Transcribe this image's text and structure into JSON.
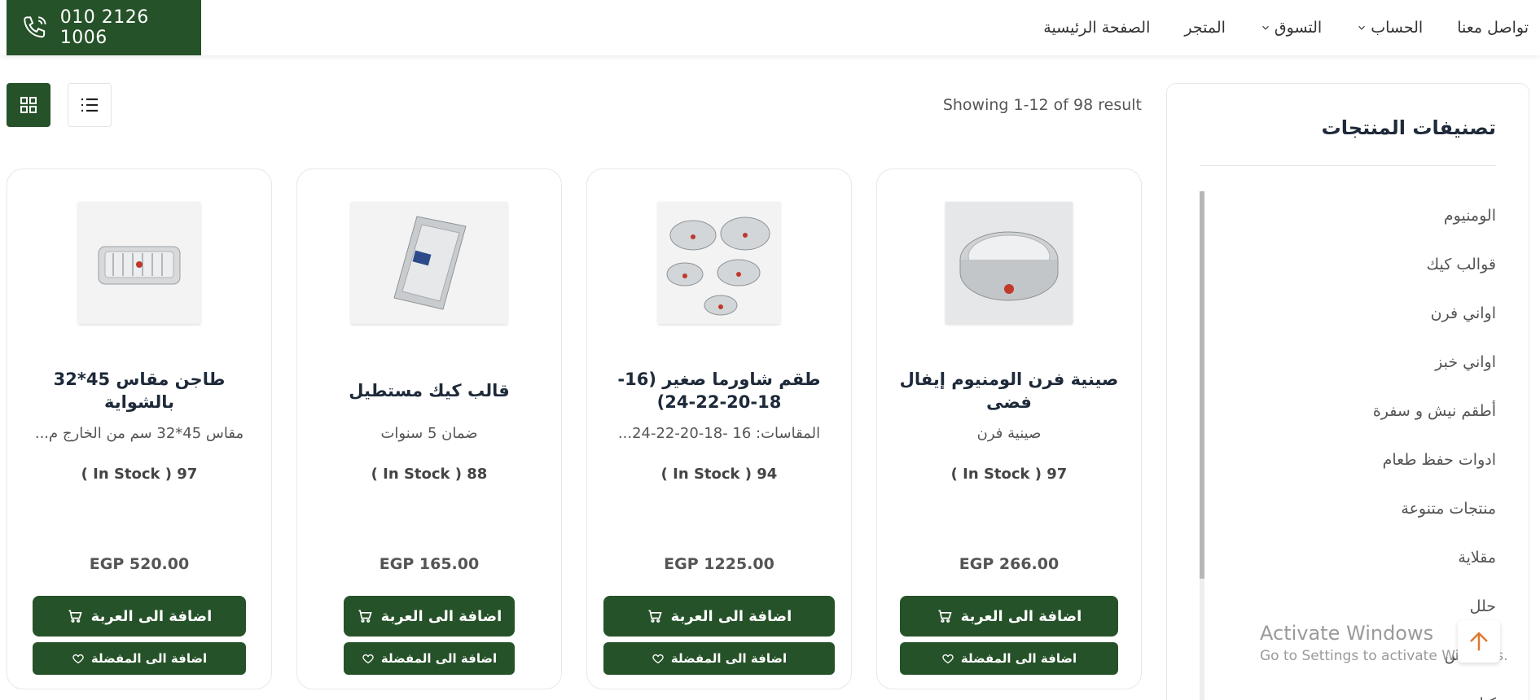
{
  "header": {
    "phone": "010 2126 1006",
    "nav": [
      {
        "label": "الصفحة الرئيسية",
        "dropdown": false
      },
      {
        "label": "المتجر",
        "dropdown": false
      },
      {
        "label": "التسوق",
        "dropdown": true
      },
      {
        "label": "الحساب",
        "dropdown": true
      },
      {
        "label": "تواصل معنا",
        "dropdown": false
      }
    ]
  },
  "toolbar": {
    "result_text": "Showing 1-12 of 98 result",
    "grid_icon": "grid-icon",
    "list_icon": "list-icon"
  },
  "products": [
    {
      "title": "صينية فرن الومنيوم إيفال فضى",
      "subtitle": "صينية فرن",
      "stock": "( In Stock ) 97",
      "price": "EGP 266.00",
      "cart_label": "اضافة الى العربة",
      "fav_label": "اضافة الى المفضلة"
    },
    {
      "title": "طقم شاورما صغير (16-18-20-22-24)",
      "subtitle": "المقاسات: 16 -18-20-22-24...",
      "stock": "( In Stock ) 94",
      "price": "EGP 1225.00",
      "cart_label": "اضافة الى العربة",
      "fav_label": "اضافة الى المفضلة"
    },
    {
      "title": "قالب كيك مستطيل",
      "subtitle": "ضمان 5 سنوات",
      "stock": "( In Stock ) 88",
      "price": "EGP 165.00",
      "cart_label": "اضافة الى العربة",
      "fav_label": "اضافة الى المفضلة"
    },
    {
      "title": "طاجن مقاس 45*32 بالشواية",
      "subtitle": "مقاس 45*32 سم من الخارج م...",
      "stock": "( In Stock ) 97",
      "price": "EGP 520.00",
      "cart_label": "اضافة الى العربة",
      "fav_label": "اضافة الى المفضلة"
    }
  ],
  "sidebar": {
    "title": "تصنيفات المنتجات",
    "items": [
      "الومنيوم",
      "قوالب كيك",
      "اواني فرن",
      "اواني خبز",
      "أطقم نيش و سفرة",
      "ادوات حفظ طعام",
      "منتجات متنوعة",
      "مقلاية",
      "حلل",
      "ستانلس",
      "كنك"
    ]
  },
  "overlay": {
    "activate_title": "Activate Windows",
    "activate_sub": "Go to Settings to activate Windows."
  },
  "colors": {
    "brand": "#265229",
    "accent_arrow": "#e0782f"
  }
}
